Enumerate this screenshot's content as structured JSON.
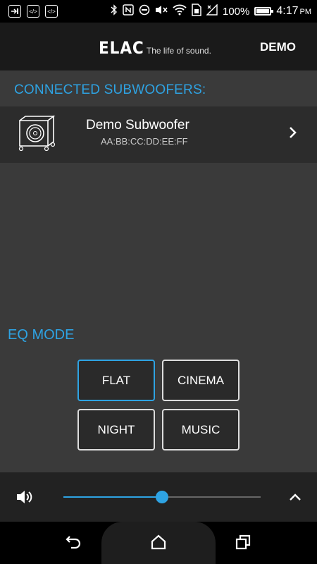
{
  "status_bar": {
    "left_icons": [
      "message-icon",
      "code-icon",
      "code-icon"
    ],
    "battery": "100%",
    "time": "4:17",
    "time_suffix": "PM"
  },
  "header": {
    "brand": "ELAC",
    "tagline": "The life of sound.",
    "demo_label": "DEMO"
  },
  "connected": {
    "title": "CONNECTED SUBWOOFERS:",
    "devices": [
      {
        "name": "Demo Subwoofer",
        "mac": "AA:BB:CC:DD:EE:FF"
      }
    ]
  },
  "eq": {
    "title": "EQ MODE",
    "modes": [
      "FLAT",
      "CINEMA",
      "NIGHT",
      "MUSIC"
    ],
    "selected": "FLAT"
  },
  "volume": {
    "level": 0.5
  },
  "colors": {
    "accent": "#2ea3e3",
    "background": "#3a3a3a",
    "header": "#1a1a1a"
  }
}
